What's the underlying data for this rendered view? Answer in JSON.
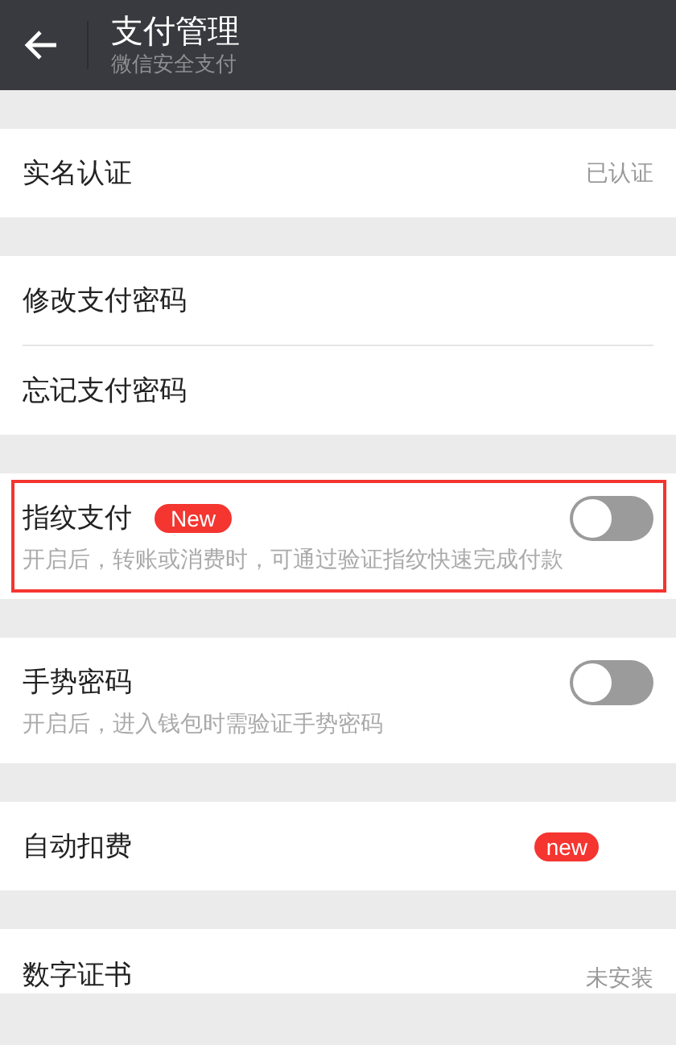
{
  "header": {
    "title": "支付管理",
    "subtitle": "微信安全支付"
  },
  "groups": [
    {
      "items": [
        {
          "kind": "value",
          "label": "实名认证",
          "value": "已认证"
        }
      ]
    },
    {
      "items": [
        {
          "kind": "link",
          "label": "修改支付密码"
        },
        {
          "kind": "link",
          "label": "忘记支付密码"
        }
      ]
    },
    {
      "items": [
        {
          "kind": "toggle",
          "label": "指纹支付",
          "badge": "New",
          "on": false,
          "highlighted": true,
          "description": "开启后，转账或消费时，可通过验证指纹快速完成付款"
        }
      ]
    },
    {
      "items": [
        {
          "kind": "toggle",
          "label": "手势密码",
          "on": false,
          "highlighted": false,
          "description": "开启后，进入钱包时需验证手势密码"
        }
      ]
    },
    {
      "items": [
        {
          "kind": "link",
          "label": "自动扣费",
          "badge": "new"
        }
      ]
    },
    {
      "items": [
        {
          "kind": "value",
          "label": "数字证书",
          "value": "未安装"
        }
      ]
    }
  ]
}
